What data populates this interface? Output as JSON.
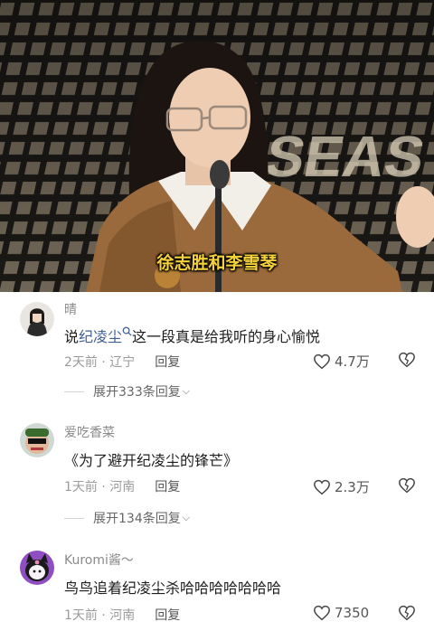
{
  "video": {
    "subtitle": "徐志胜和李雪琴"
  },
  "comments": [
    {
      "username": "晴",
      "text_before": "说",
      "link_text": "纪凌尘",
      "text_after": "这一段真是给我听的身心愉悦",
      "time": "2天前",
      "location": "辽宁",
      "reply_label": "回复",
      "likes": "4.7万",
      "expand_label": "展开333条回复"
    },
    {
      "username": "爱吃香菜",
      "text": "《为了避开纪凌尘的锋芒》",
      "time": "1天前",
      "location": "河南",
      "reply_label": "回复",
      "likes": "2.3万",
      "expand_label": "展开134条回复"
    },
    {
      "username": "Kuromi酱～",
      "text": "鸟鸟追着纪凌尘杀哈哈哈哈哈哈哈",
      "time": "1天前",
      "location": "河南",
      "reply_label": "回复",
      "likes": "7350"
    }
  ],
  "colors": {
    "subtitle": "#f6d23a",
    "link": "#3f5f95",
    "meta": "#9b9b9b"
  },
  "icons": [
    "heart-icon",
    "broken-heart-icon",
    "search-icon",
    "chevron-down-icon"
  ]
}
